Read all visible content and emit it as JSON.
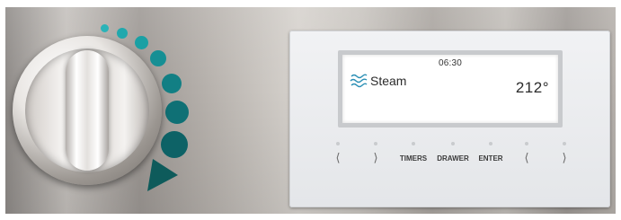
{
  "knob": {
    "indicator_dots_color": "#117a7a",
    "pointer_color": "#0e5b5b"
  },
  "display": {
    "time": "06:30",
    "mode_icon": "steam-icon",
    "mode": "Steam",
    "temperature": "212°"
  },
  "controls": [
    {
      "label": "⟨",
      "icon": "chevron-left-icon"
    },
    {
      "label": "⟩",
      "icon": "chevron-right-icon"
    },
    {
      "label": "TIMERS"
    },
    {
      "label": "DRAWER"
    },
    {
      "label": "ENTER"
    },
    {
      "label": "⟨",
      "icon": "chevron-left-icon"
    },
    {
      "label": "⟩",
      "icon": "chevron-right-icon"
    }
  ]
}
